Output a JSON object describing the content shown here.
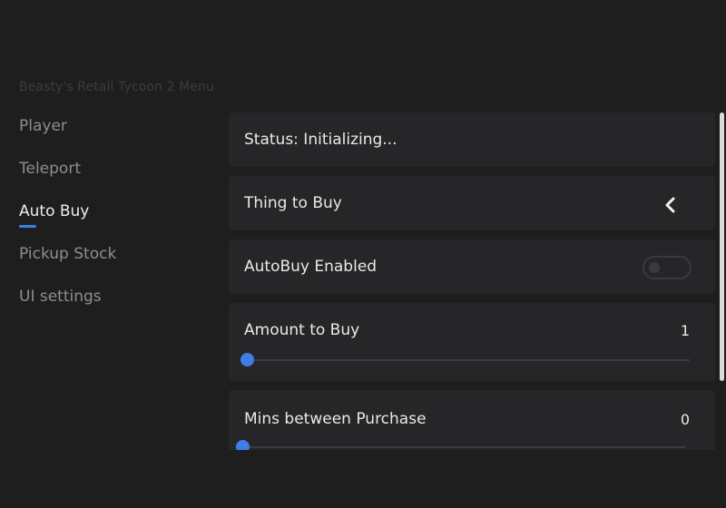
{
  "window": {
    "title": "Beasty's Retail Tycoon 2 Menu"
  },
  "sidebar": {
    "items": [
      {
        "label": "Player",
        "active": false
      },
      {
        "label": "Teleport",
        "active": false
      },
      {
        "label": "Auto Buy",
        "active": true
      },
      {
        "label": "Pickup Stock",
        "active": false
      },
      {
        "label": "UI settings",
        "active": false
      }
    ]
  },
  "autobuy": {
    "status_label": "Status: Initializing...",
    "thing_to_buy": {
      "label": "Thing to Buy",
      "icon": "chevron-left-icon"
    },
    "autobuy_enabled": {
      "label": "AutoBuy Enabled",
      "enabled": false
    },
    "amount_to_buy": {
      "label": "Amount to Buy",
      "value": "1",
      "fraction": 0
    },
    "mins_between_purchase": {
      "label": "Mins between Purchase",
      "value": "0",
      "fraction": 0
    }
  },
  "colors": {
    "background": "#1e1e1f",
    "panel": "#262628",
    "accent": "#3e7ee6"
  }
}
